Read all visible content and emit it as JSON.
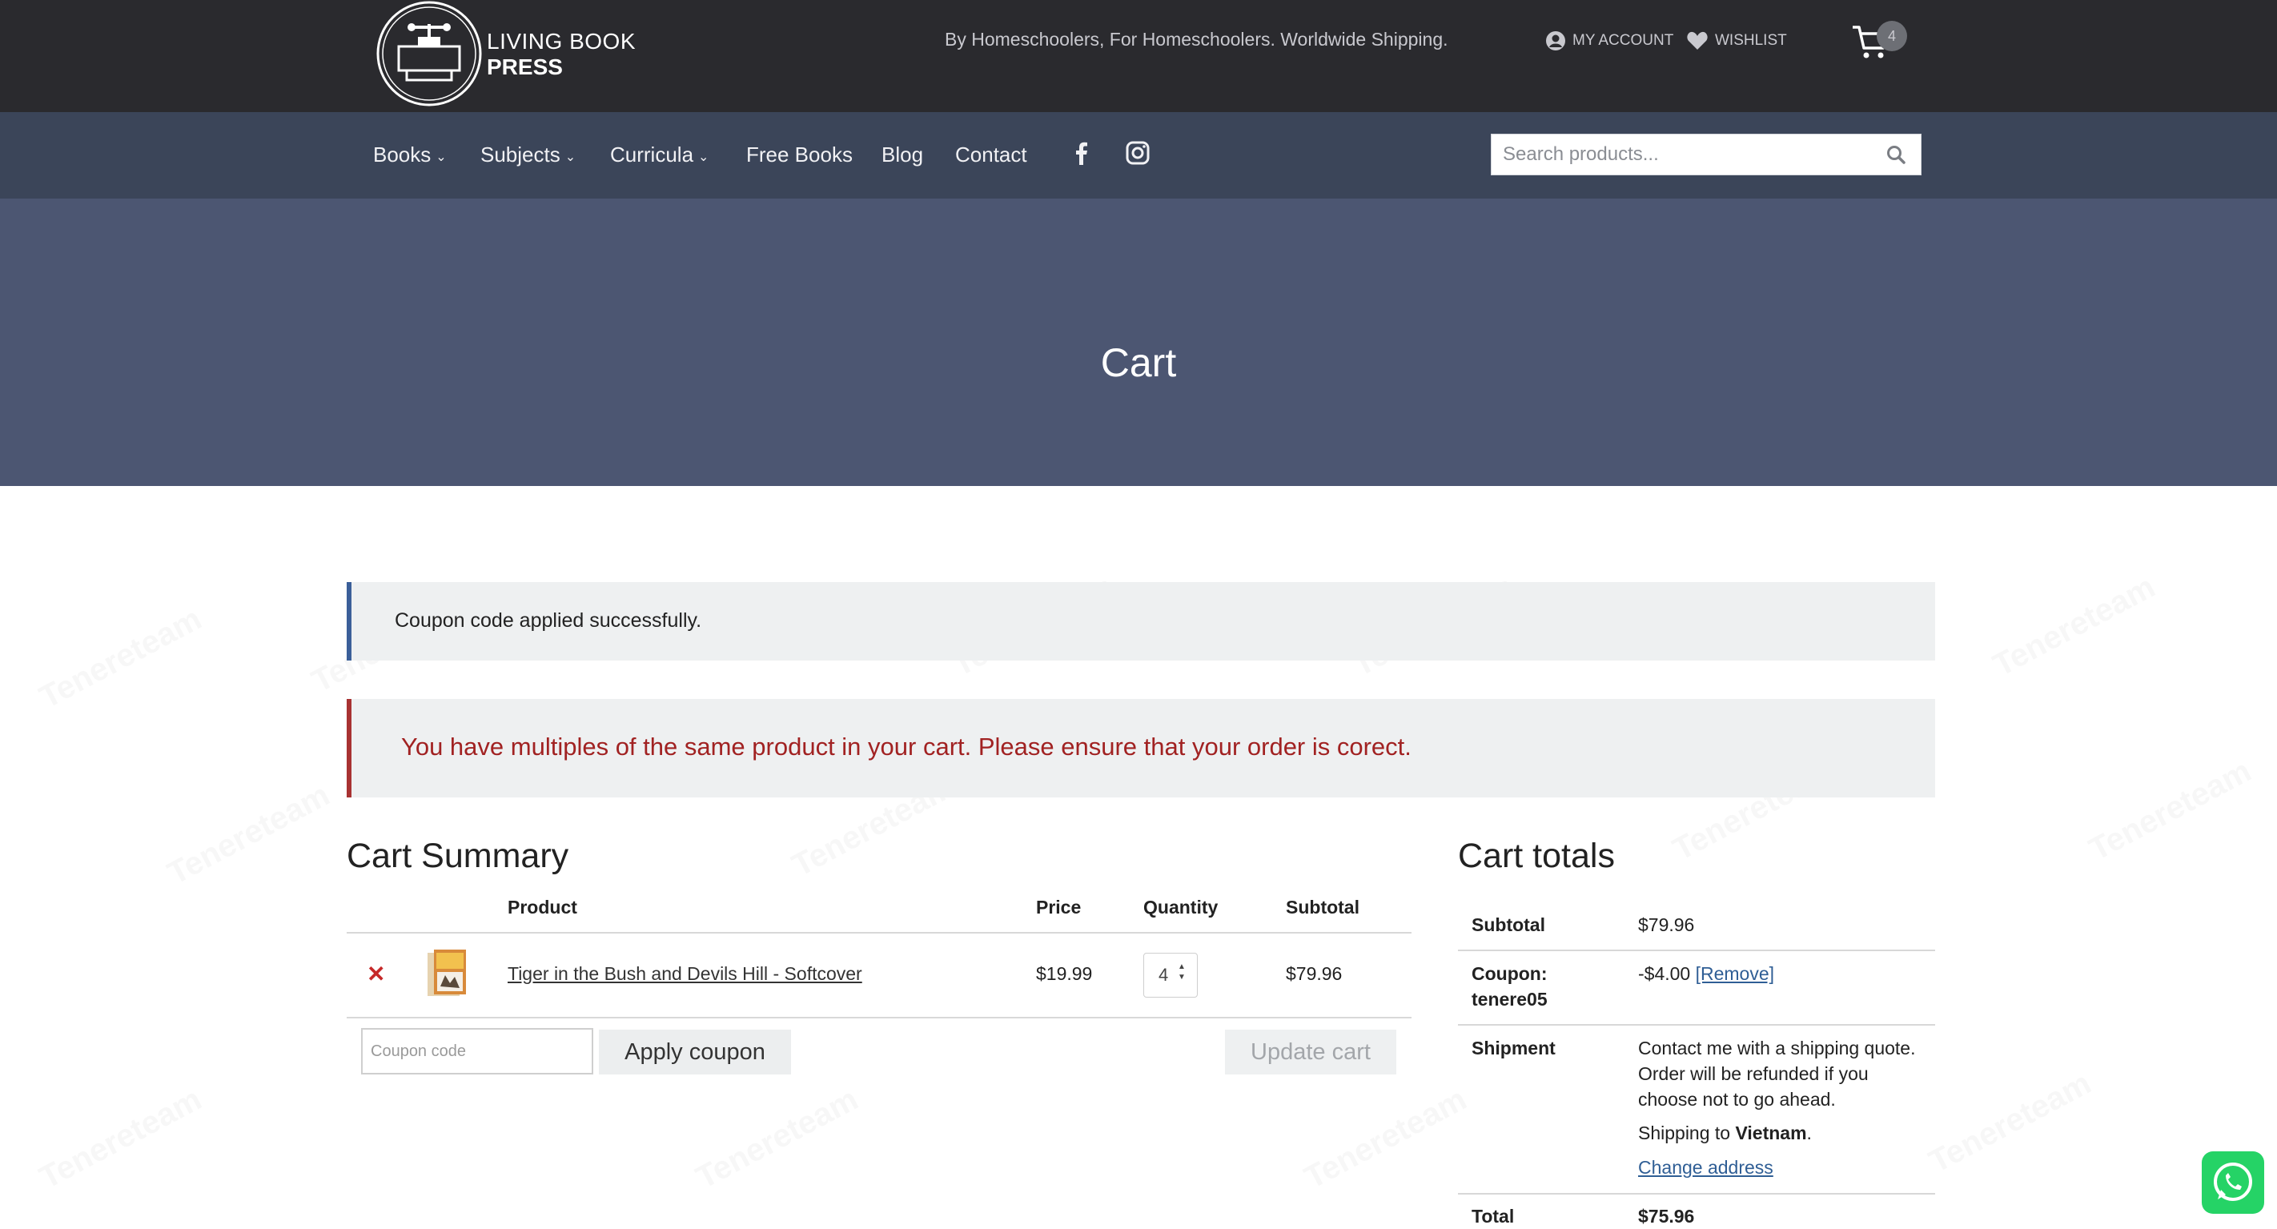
{
  "brand": {
    "line1": "LIVING BOOK",
    "line2": "PRESS"
  },
  "topbar": {
    "tagline": "By Homeschoolers, For Homeschoolers. Worldwide Shipping.",
    "account_label": "MY ACCOUNT",
    "wishlist_label": "WISHLIST",
    "cart_count": "4"
  },
  "nav": {
    "items": [
      {
        "label": "Books",
        "has_dropdown": true
      },
      {
        "label": "Subjects",
        "has_dropdown": true
      },
      {
        "label": "Curricula",
        "has_dropdown": true
      },
      {
        "label": "Free Books",
        "has_dropdown": false
      },
      {
        "label": "Blog",
        "has_dropdown": false
      },
      {
        "label": "Contact",
        "has_dropdown": false
      }
    ],
    "social": [
      "facebook-icon",
      "instagram-icon"
    ],
    "search_placeholder": "Search products..."
  },
  "hero": {
    "title": "Cart"
  },
  "notices": {
    "success": "Coupon code applied successfully.",
    "error": "You have multiples of the same product in your cart. Please ensure that your order is corect."
  },
  "cart_summary": {
    "heading": "Cart Summary",
    "columns": {
      "product": "Product",
      "price": "Price",
      "quantity": "Quantity",
      "subtotal": "Subtotal"
    },
    "rows": [
      {
        "name": "Tiger in the Bush and Devils Hill - Softcover",
        "price": "$19.99",
        "quantity": "4",
        "subtotal": "$79.96"
      }
    ],
    "coupon_placeholder": "Coupon code",
    "apply_label": "Apply coupon",
    "update_label": "Update cart"
  },
  "cart_totals": {
    "heading": "Cart totals",
    "subtotal_label": "Subtotal",
    "subtotal_value": "$79.96",
    "coupon_label_1": "Coupon:",
    "coupon_label_2": "tenere05",
    "coupon_value": "-$4.00",
    "coupon_remove": "[Remove]",
    "shipment_label": "Shipment",
    "shipment_text": "Contact me with a shipping quote. Order will be refunded if you choose not to go ahead.",
    "shipping_to_prefix": "Shipping to",
    "shipping_country": "Vietnam",
    "change_address": "Change address",
    "total_label": "Total",
    "total_value": "$75.96"
  },
  "watermark_text": "Tenereteam",
  "colors": {
    "topbar": "#2a2a2e",
    "nav": "#3b4559",
    "hero": "#4c5672",
    "error": "#a12222",
    "info_border": "#3b5f99"
  }
}
